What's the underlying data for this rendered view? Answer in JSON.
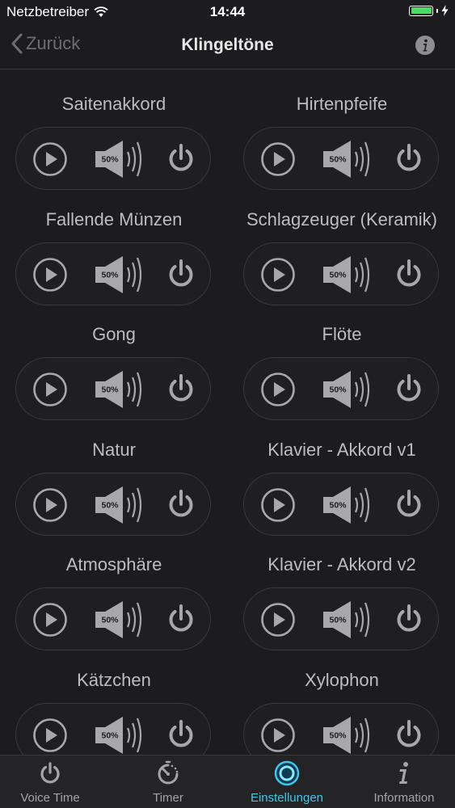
{
  "status_bar": {
    "carrier": "Netzbetreiber",
    "time": "14:44"
  },
  "nav": {
    "back_label": "Zurück",
    "title": "Klingeltöne"
  },
  "volume_label": "50%",
  "ringtones": [
    {
      "name": "Saitenakkord",
      "volume_percent": 50
    },
    {
      "name": "Hirtenpfeife",
      "volume_percent": 50
    },
    {
      "name": "Fallende Münzen",
      "volume_percent": 50
    },
    {
      "name": "Schlagzeuger (Keramik)",
      "volume_percent": 50
    },
    {
      "name": "Gong",
      "volume_percent": 50
    },
    {
      "name": "Flöte",
      "volume_percent": 50
    },
    {
      "name": "Natur",
      "volume_percent": 50
    },
    {
      "name": "Klavier - Akkord v1",
      "volume_percent": 50
    },
    {
      "name": "Atmosphäre",
      "volume_percent": 50
    },
    {
      "name": "Klavier - Akkord v2",
      "volume_percent": 50
    },
    {
      "name": "Kätzchen",
      "volume_percent": 50
    },
    {
      "name": "Xylophon",
      "volume_percent": 50
    }
  ],
  "tabs": [
    {
      "label": "Voice Time",
      "icon": "power-icon"
    },
    {
      "label": "Timer",
      "icon": "timer-icon"
    },
    {
      "label": "Einstellungen",
      "icon": "settings-icon",
      "active": true
    },
    {
      "label": "Information",
      "icon": "info-icon"
    }
  ],
  "colors": {
    "background": "#1c1c1e",
    "accent": "#3ec7ee",
    "battery": "#4cd964",
    "control": "#a8a8aa"
  }
}
